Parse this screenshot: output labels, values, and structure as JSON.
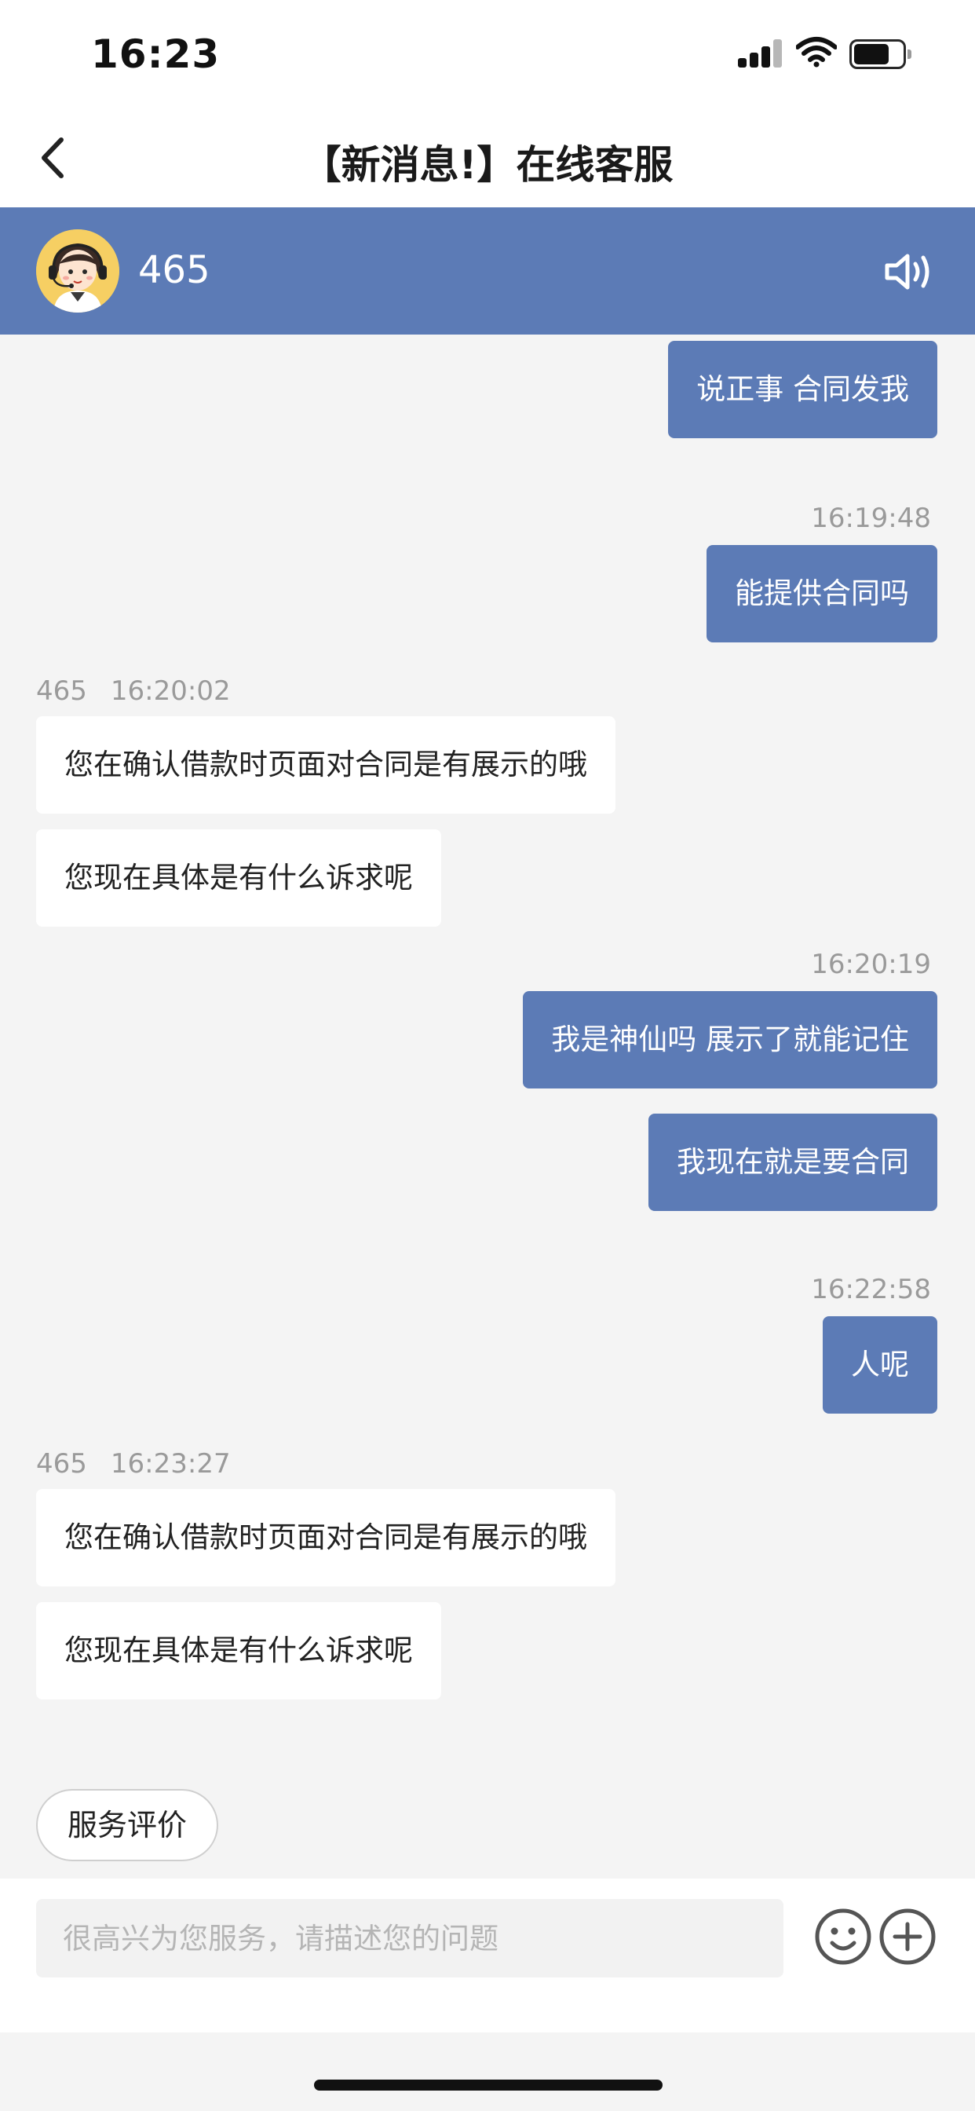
{
  "status_bar": {
    "time": "16:23"
  },
  "nav": {
    "title": "【新消息!】在线客服"
  },
  "agent": {
    "name": "465"
  },
  "messages": {
    "m1": {
      "text": "说正事 合同发我"
    },
    "t2": "16:19:48",
    "m2": {
      "text": "能提供合同吗"
    },
    "g3": {
      "sender": "465",
      "time": "16:20:02"
    },
    "m3": {
      "text": "您在确认借款时页面对合同是有展示的哦"
    },
    "m4": {
      "text": "您现在具体是有什么诉求呢"
    },
    "t5": "16:20:19",
    "m5": {
      "text": "我是神仙吗 展示了就能记住"
    },
    "m6": {
      "text": "我现在就是要合同"
    },
    "t7": "16:22:58",
    "m7": {
      "text": "人呢"
    },
    "g8": {
      "sender": "465",
      "time": "16:23:27"
    },
    "m8": {
      "text": "您在确认借款时页面对合同是有展示的哦"
    },
    "m9": {
      "text": "您现在具体是有什么诉求呢"
    }
  },
  "rating_button": {
    "label": "服务评价"
  },
  "input": {
    "placeholder": "很高兴为您服务，请描述您的问题"
  },
  "icons": {
    "back": "chevron-left-icon",
    "sound": "speaker-icon",
    "emoji": "smiley-icon",
    "plus": "plus-circle-icon"
  },
  "colors": {
    "accent": "#5c7bb6",
    "background": "#f4f4f4"
  }
}
